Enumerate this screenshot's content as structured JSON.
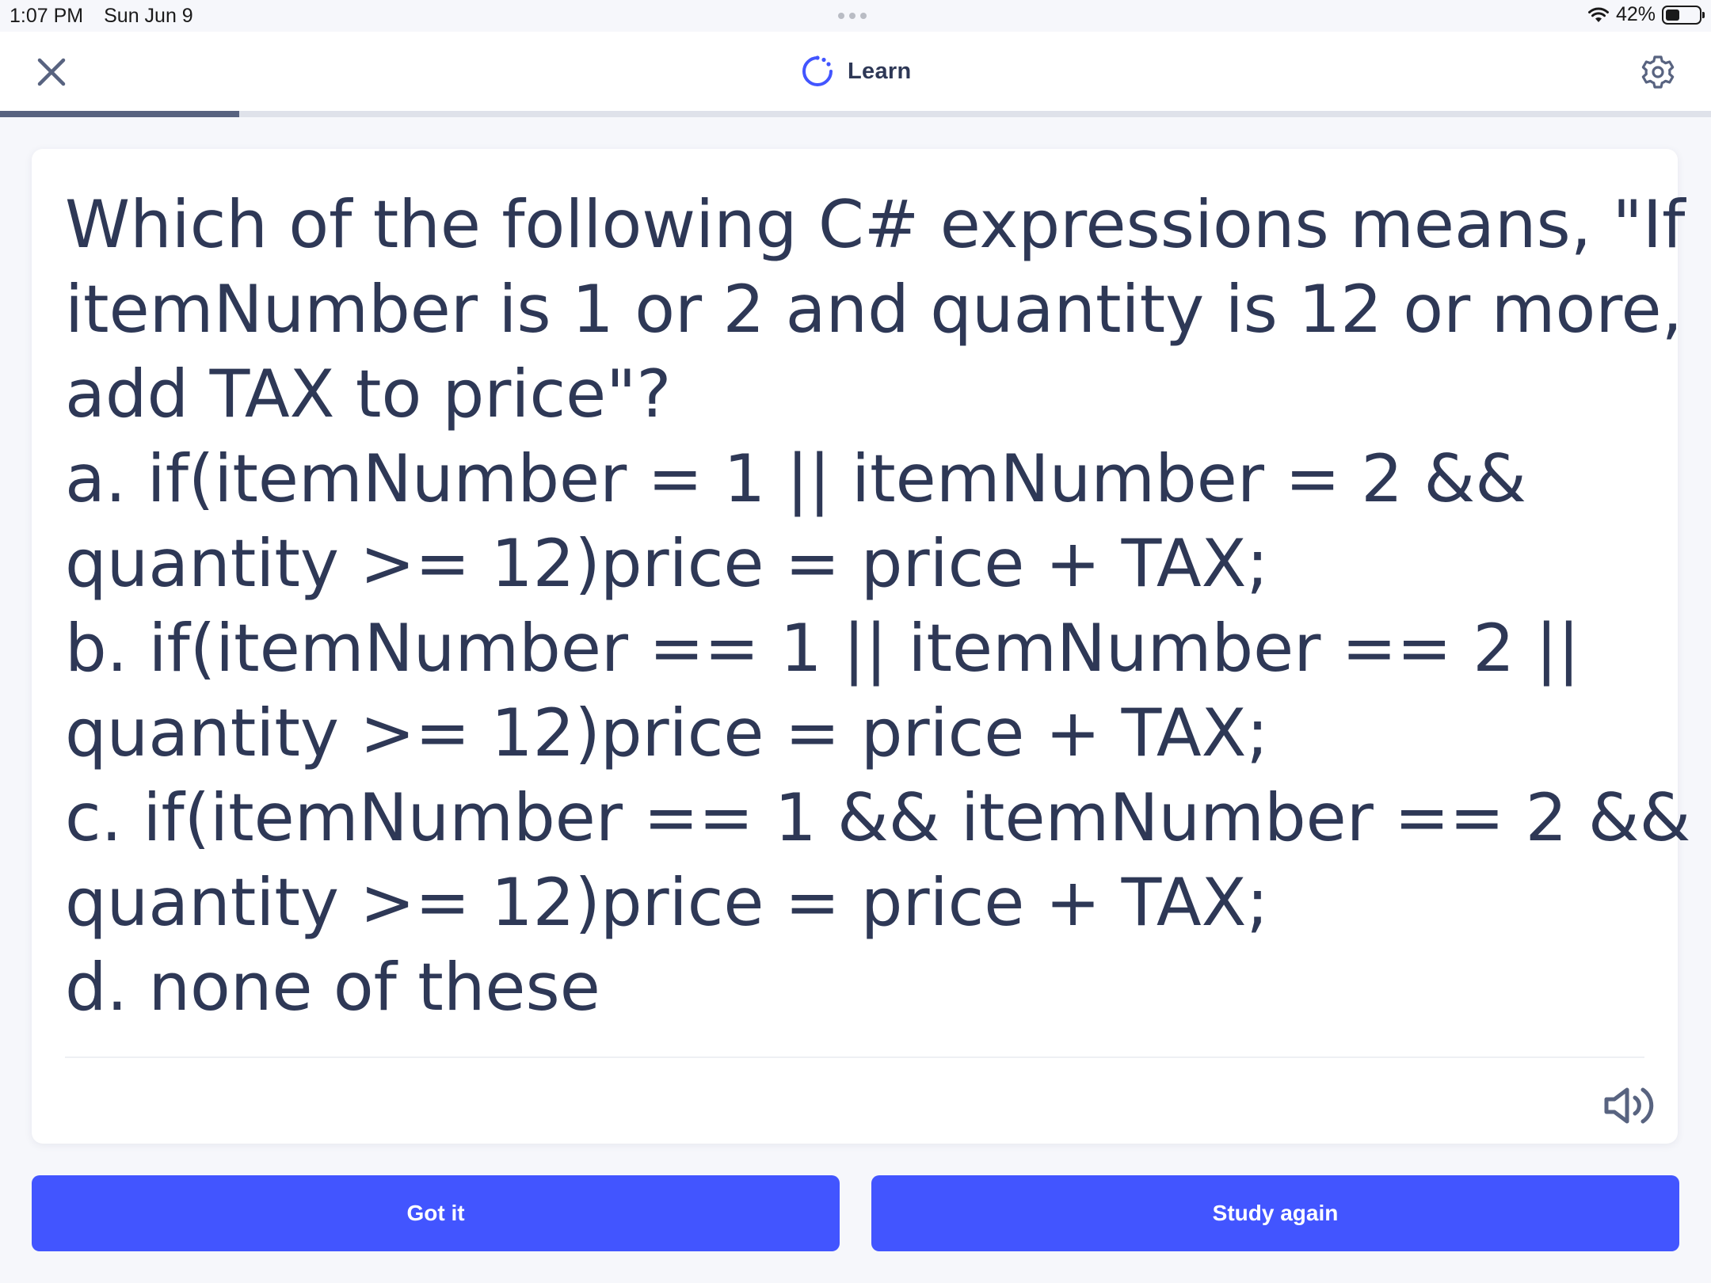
{
  "status_bar": {
    "time": "1:07 PM",
    "date": "Sun Jun 9",
    "battery": "42%",
    "battery_level": 0.42
  },
  "header": {
    "title": "Learn",
    "progress": 0.14,
    "icons": {
      "close": "close-icon",
      "mode": "learn-icon",
      "settings": "gear-icon"
    }
  },
  "card": {
    "question_lines": [
      "Which of the following C# expressions means, \"If",
      "itemNumber is 1 or 2 and quantity is 12 or more,",
      "add TAX to price\"?",
      "a. if(itemNumber = 1 || itemNumber = 2 &&",
      "quantity >= 12)price = price + TAX;",
      "b. if(itemNumber == 1 || itemNumber == 2 ||",
      "quantity >= 12)price = price + TAX;",
      "c. if(itemNumber == 1 && itemNumber == 2 &&",
      "quantity >= 12)price = price + TAX;",
      "d. none of these"
    ],
    "audio_icon": "speaker-icon"
  },
  "actions": {
    "got_it": "Got it",
    "study_again": "Study again"
  },
  "colors": {
    "accent": "#4255ff",
    "text": "#2e3856",
    "progress": "#586380",
    "background": "#f6f7fb"
  }
}
